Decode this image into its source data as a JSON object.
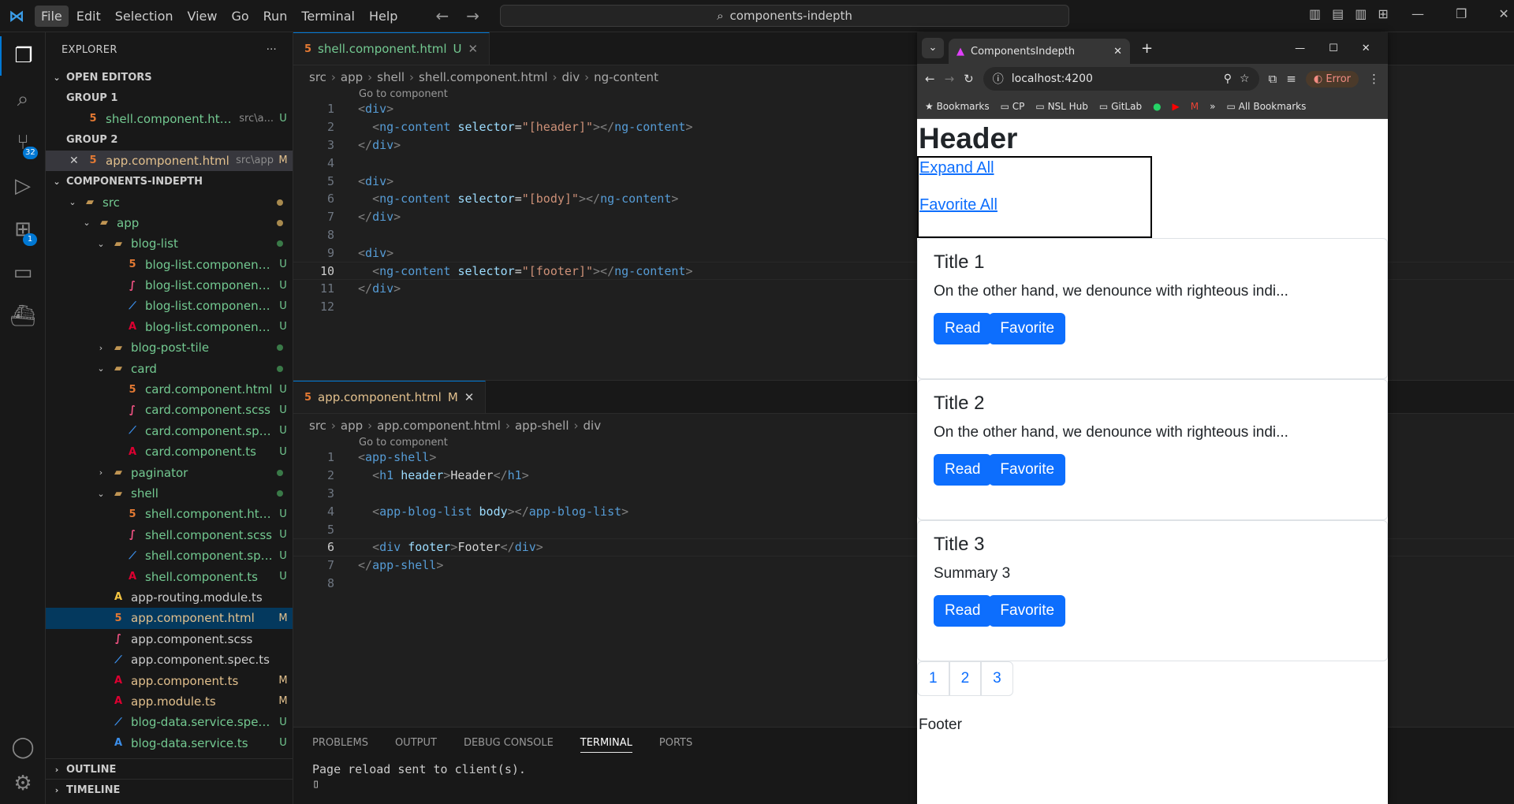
{
  "titlebar": {
    "menu": [
      "File",
      "Edit",
      "Selection",
      "View",
      "Go",
      "Run",
      "Terminal",
      "Help"
    ],
    "search": "components-indepth"
  },
  "activity": {
    "source_control_badge": "32",
    "extensions_badge": "1"
  },
  "explorer": {
    "title": "EXPLORER",
    "open_editors": "OPEN EDITORS",
    "group1": "GROUP 1",
    "group1_file": "shell.component.html",
    "group1_path": "src\\a...",
    "group1_status": "U",
    "group2": "GROUP 2",
    "group2_file": "app.component.html",
    "group2_path": "src\\app",
    "group2_status": "M",
    "project": "COMPONENTS-INDEPTH",
    "tree": [
      {
        "label": "src",
        "depth": 1,
        "type": "folder",
        "open": true,
        "status": "dot"
      },
      {
        "label": "app",
        "depth": 2,
        "type": "folder",
        "open": true,
        "status": "dot"
      },
      {
        "label": "blog-list",
        "depth": 3,
        "type": "folder",
        "open": true,
        "status": "dot-green"
      },
      {
        "label": "blog-list.component.html",
        "depth": 4,
        "type": "html",
        "status": "U"
      },
      {
        "label": "blog-list.component.scss",
        "depth": 4,
        "type": "scss",
        "status": "U"
      },
      {
        "label": "blog-list.component.spe...",
        "depth": 4,
        "type": "spec",
        "status": "U"
      },
      {
        "label": "blog-list.component.ts",
        "depth": 4,
        "type": "ts",
        "status": "U"
      },
      {
        "label": "blog-post-tile",
        "depth": 3,
        "type": "folder",
        "open": false,
        "status": "dot-green"
      },
      {
        "label": "card",
        "depth": 3,
        "type": "folder",
        "open": true,
        "status": "dot-green"
      },
      {
        "label": "card.component.html",
        "depth": 4,
        "type": "html",
        "status": "U"
      },
      {
        "label": "card.component.scss",
        "depth": 4,
        "type": "scss",
        "status": "U"
      },
      {
        "label": "card.component.spec.ts",
        "depth": 4,
        "type": "spec",
        "status": "U"
      },
      {
        "label": "card.component.ts",
        "depth": 4,
        "type": "ts",
        "status": "U"
      },
      {
        "label": "paginator",
        "depth": 3,
        "type": "folder",
        "open": false,
        "status": "dot-green"
      },
      {
        "label": "shell",
        "depth": 3,
        "type": "folder",
        "open": true,
        "status": "dot-green"
      },
      {
        "label": "shell.component.html",
        "depth": 4,
        "type": "html",
        "status": "U"
      },
      {
        "label": "shell.component.scss",
        "depth": 4,
        "type": "scss",
        "status": "U"
      },
      {
        "label": "shell.component.spec.ts",
        "depth": 4,
        "type": "spec",
        "status": "U"
      },
      {
        "label": "shell.component.ts",
        "depth": 4,
        "type": "ts",
        "status": "U"
      },
      {
        "label": "app-routing.module.ts",
        "depth": 3,
        "type": "ts-plain",
        "status": ""
      },
      {
        "label": "app.component.html",
        "depth": 3,
        "type": "html",
        "status": "M",
        "selected": true
      },
      {
        "label": "app.component.scss",
        "depth": 3,
        "type": "scss-plain",
        "status": ""
      },
      {
        "label": "app.component.spec.ts",
        "depth": 3,
        "type": "spec-plain",
        "status": ""
      },
      {
        "label": "app.component.ts",
        "depth": 3,
        "type": "ts",
        "status": "M",
        "mod": true
      },
      {
        "label": "app.module.ts",
        "depth": 3,
        "type": "ts",
        "status": "M",
        "mod": true
      },
      {
        "label": "blog-data.service.spec.ts",
        "depth": 3,
        "type": "spec",
        "status": "U"
      },
      {
        "label": "blog-data.service.ts",
        "depth": 3,
        "type": "svc",
        "status": "U"
      }
    ],
    "outline": "OUTLINE",
    "timeline": "TIMELINE"
  },
  "editor1": {
    "tab": "shell.component.html",
    "tab_status": "U",
    "breadcrumb": [
      "src",
      "app",
      "shell",
      "shell.component.html",
      "div",
      "ng-content"
    ],
    "codelens": "Go to component",
    "lines": [
      [
        [
          "tg",
          "<"
        ],
        [
          "tn",
          "div"
        ],
        [
          "tg",
          ">"
        ]
      ],
      [
        [
          "wt",
          "  "
        ],
        [
          "tg",
          "<"
        ],
        [
          "tn",
          "ng-content"
        ],
        [
          "wt",
          " "
        ],
        [
          "an",
          "selector"
        ],
        [
          "wt",
          "="
        ],
        [
          "av",
          "\"[header]\""
        ],
        [
          "tg",
          "></"
        ],
        [
          "tn",
          "ng-content"
        ],
        [
          "tg",
          ">"
        ]
      ],
      [
        [
          "tg",
          "</"
        ],
        [
          "tn",
          "div"
        ],
        [
          "tg",
          ">"
        ]
      ],
      [],
      [
        [
          "tg",
          "<"
        ],
        [
          "tn",
          "div"
        ],
        [
          "tg",
          ">"
        ]
      ],
      [
        [
          "wt",
          "  "
        ],
        [
          "tg",
          "<"
        ],
        [
          "tn",
          "ng-content"
        ],
        [
          "wt",
          " "
        ],
        [
          "an",
          "selector"
        ],
        [
          "wt",
          "="
        ],
        [
          "av",
          "\"[body]\""
        ],
        [
          "tg",
          "></"
        ],
        [
          "tn",
          "ng-content"
        ],
        [
          "tg",
          ">"
        ]
      ],
      [
        [
          "tg",
          "</"
        ],
        [
          "tn",
          "div"
        ],
        [
          "tg",
          ">"
        ]
      ],
      [],
      [
        [
          "tg",
          "<"
        ],
        [
          "tn",
          "div"
        ],
        [
          "tg",
          ">"
        ]
      ],
      [
        [
          "wt",
          "  "
        ],
        [
          "tg",
          "<"
        ],
        [
          "tn",
          "ng-content"
        ],
        [
          "wt",
          " "
        ],
        [
          "an",
          "selector"
        ],
        [
          "wt",
          "="
        ],
        [
          "av",
          "\"[footer]\""
        ],
        [
          "tg",
          "></"
        ],
        [
          "tn",
          "ng-content"
        ],
        [
          "tg",
          ">"
        ]
      ],
      [
        [
          "tg",
          "</"
        ],
        [
          "tn",
          "div"
        ],
        [
          "tg",
          ">"
        ]
      ],
      []
    ],
    "current_line": 10
  },
  "editor2": {
    "tab": "app.component.html",
    "tab_status": "M",
    "breadcrumb": [
      "src",
      "app",
      "app.component.html",
      "app-shell",
      "div"
    ],
    "codelens": "Go to component",
    "lines": [
      [
        [
          "tg",
          "<"
        ],
        [
          "tn",
          "app-shell"
        ],
        [
          "tg",
          ">"
        ]
      ],
      [
        [
          "wt",
          "  "
        ],
        [
          "tg",
          "<"
        ],
        [
          "tn",
          "h1"
        ],
        [
          "wt",
          " "
        ],
        [
          "an",
          "header"
        ],
        [
          "tg",
          ">"
        ],
        [
          "wt",
          "Header"
        ],
        [
          "tg",
          "</"
        ],
        [
          "tn",
          "h1"
        ],
        [
          "tg",
          ">"
        ]
      ],
      [],
      [
        [
          "wt",
          "  "
        ],
        [
          "tg",
          "<"
        ],
        [
          "tn",
          "app-blog-list"
        ],
        [
          "wt",
          " "
        ],
        [
          "an",
          "body"
        ],
        [
          "tg",
          "></"
        ],
        [
          "tn",
          "app-blog-list"
        ],
        [
          "tg",
          ">"
        ]
      ],
      [],
      [
        [
          "wt",
          "  "
        ],
        [
          "tg",
          "<"
        ],
        [
          "tn",
          "div"
        ],
        [
          "wt",
          " "
        ],
        [
          "an",
          "footer"
        ],
        [
          "tg",
          ">"
        ],
        [
          "wt",
          "Footer"
        ],
        [
          "tg",
          "</"
        ],
        [
          "tn",
          "div"
        ],
        [
          "tg",
          ">"
        ]
      ],
      [
        [
          "tg",
          "</"
        ],
        [
          "tn",
          "app-shell"
        ],
        [
          "tg",
          ">"
        ]
      ],
      []
    ],
    "current_line": 6
  },
  "panel": {
    "tabs": [
      "PROBLEMS",
      "OUTPUT",
      "DEBUG CONSOLE",
      "TERMINAL",
      "PORTS"
    ],
    "active": "TERMINAL",
    "output": "Page reload sent to client(s)."
  },
  "browser": {
    "tab_title": "ComponentsIndepth",
    "url": "localhost:4200",
    "error_label": "Error",
    "bookmarks": [
      "Bookmarks",
      "CP",
      "NSL Hub",
      "GitLab",
      "All Bookmarks"
    ],
    "page": {
      "header": "Header",
      "links": [
        "Expand All",
        "Favorite All"
      ],
      "cards": [
        {
          "title": "Title 1",
          "summary": "On the other hand, we denounce with righteous indi..."
        },
        {
          "title": "Title 2",
          "summary": "On the other hand, we denounce with righteous indi..."
        },
        {
          "title": "Title 3",
          "summary": "Summary 3"
        }
      ],
      "read_label": "Read",
      "favorite_label": "Favorite",
      "pages": [
        "1",
        "2",
        "3"
      ],
      "footer": "Footer"
    }
  }
}
